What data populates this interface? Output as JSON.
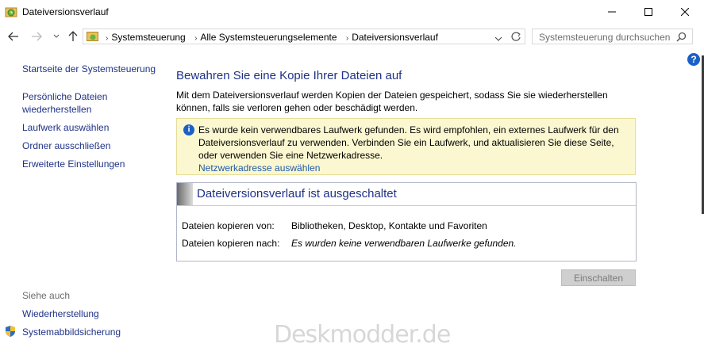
{
  "window": {
    "title": "Dateiversionsverlauf",
    "controls": {
      "minimize": "—",
      "maximize": "☐",
      "close": "✕"
    }
  },
  "address": {
    "crumbs": [
      "Systemsteuerung",
      "Alle Systemsteuerungselemente",
      "Dateiversionsverlauf"
    ],
    "search_placeholder": "Systemsteuerung durchsuchen"
  },
  "sidebar": {
    "home": "Startseite der Systemsteuerung",
    "restore_line1": "Persönliche Dateien",
    "restore_line2": "wiederherstellen",
    "select_drive": "Laufwerk auswählen",
    "exclude": "Ordner ausschließen",
    "advanced": "Erweiterte Einstellungen",
    "see_also": "Siehe auch",
    "recovery": "Wiederherstellung",
    "system_image": "Systemabbildsicherung"
  },
  "main": {
    "title": "Bewahren Sie eine Kopie Ihrer Dateien auf",
    "description": "Mit dem Dateiversionsverlauf werden Kopien der Dateien gespeichert, sodass Sie sie wiederherstellen können, falls sie verloren gehen oder beschädigt werden.",
    "info": {
      "text": "Es wurde kein verwendbares Laufwerk gefunden. Es wird empfohlen, ein externes Laufwerk für den Dateiversionsverlauf zu verwenden. Verbinden Sie ein Laufwerk, und aktualisieren Sie diese Seite, oder verwenden Sie eine Netzwerkadresse.",
      "link": "Netzwerkadresse auswählen"
    },
    "status": {
      "header": "Dateiversionsverlauf ist ausgeschaltet",
      "copy_from_label": "Dateien kopieren von:",
      "copy_from_value": "Bibliotheken, Desktop, Kontakte und Favoriten",
      "copy_to_label": "Dateien kopieren nach:",
      "copy_to_value": "Es wurden keine verwendbaren Laufwerke gefunden."
    },
    "enable_button": "Einschalten"
  },
  "watermark": "Deskmodder.de"
}
